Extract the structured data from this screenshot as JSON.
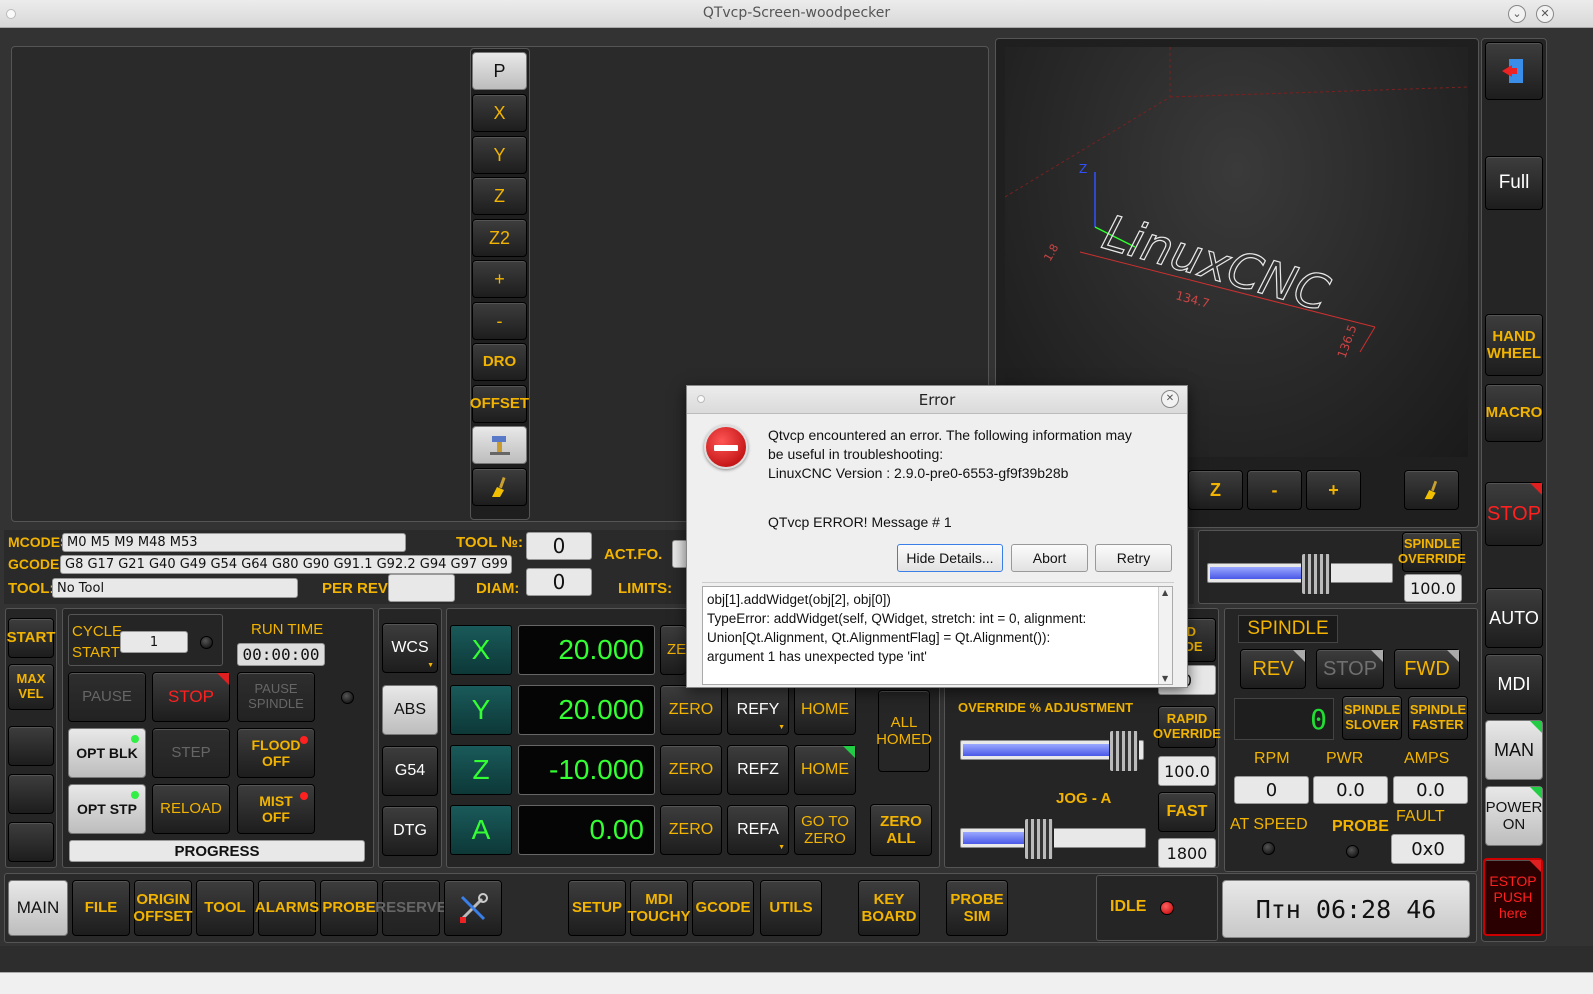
{
  "window": {
    "title": "QTvcp-Screen-woodpecker"
  },
  "quick_buttons": [
    "P",
    "X",
    "Y",
    "Z",
    "Z2",
    "+",
    "-",
    "DRO",
    "OFFSET"
  ],
  "right_nav": {
    "full": "Full",
    "hand_wheel": "HAND\nWHEEL",
    "macro": "MACRO",
    "stop": "STOP",
    "auto": "AUTO",
    "mdi": "MDI",
    "man": "MAN",
    "power_on": "POWER\nON",
    "estop": "ESTOP\nPUSH\nhere"
  },
  "preview": {
    "buttons": [
      "Z",
      "-",
      "+"
    ],
    "dims": {
      "d1": "134.7",
      "d2": "136.5",
      "d3": "1.8"
    },
    "logo": "LinuxCNC"
  },
  "codes": {
    "mcodes_label": "MCODES:",
    "mcodes": "M0 M5 M9 M48 M53",
    "gcodes_label": "GCODES:",
    "gcodes": "G8 G17 G21 G40 G49 G54 G64 G80 G90 G91.1 G92.2 G94 G97 G99",
    "tool_label": "TOOL:",
    "tool": "No Tool",
    "tool_no_label": "TOOL №:",
    "tool_no": "0",
    "per_rev_label": "PER REV:",
    "diam_label": "DIAM:",
    "diam": "0",
    "act_fo_label": "ACT.FO.",
    "limits_label": "LIMITS:"
  },
  "run": {
    "start": "START",
    "max_vel": "MAX\nVEL",
    "cycle_start": "CYCLE\nSTART",
    "cycle_value": "1",
    "run_time_label": "RUN TIME",
    "run_time": "00:00:00",
    "pause": "PAUSE",
    "stop": "STOP",
    "pause_spindle": "PAUSE\nSPINDLE",
    "opt_blk": "OPT BLK",
    "step": "STEP",
    "flood_off": "FLOOD\nOFF",
    "opt_stp": "OPT STP",
    "reload": "RELOAD",
    "mist_off": "MIST\nOFF",
    "progress": "PROGRESS"
  },
  "coord_modes": [
    "WCS",
    "ABS",
    "G54",
    "DTG"
  ],
  "axes": [
    {
      "name": "X",
      "value": "20.000",
      "ref": "REFX",
      "home": "HOME"
    },
    {
      "name": "Y",
      "value": "20.000",
      "ref": "REFY",
      "home": "HOME"
    },
    {
      "name": "Z",
      "value": "-10.000",
      "ref": "REFZ",
      "home": "HOME"
    },
    {
      "name": "A",
      "value": "0.00",
      "ref": "REFA",
      "home": "GO TO\nZERO"
    }
  ],
  "zero_label": "ZE",
  "zero": "ZERO",
  "all_homed": "ALL\nHOMED",
  "zero_all": "ZERO\nALL",
  "overrides": {
    "spindle_override": "SPINDLE\nOVERRIDE",
    "spindle_override_value": "100.0",
    "feed_override": "ED\nRIDE",
    "feed_value": "0",
    "adjust_label": "OVERRIDE % ADJUSTMENT",
    "rapid_override": "RAPID\nOVERRIDE",
    "rapid_value": "100.0",
    "jog_label": "JOG - A",
    "fast": "FAST",
    "jog_value": "1800",
    "slider_spindle_pct": 0.62,
    "slider_rapid_pct": 1.0,
    "slider_jog_pct": 0.42
  },
  "spindle": {
    "title": "SPINDLE",
    "rev": "REV",
    "stop": "STOP",
    "fwd": "FWD",
    "lcd": "0",
    "slower": "SPINDLE\nSLOVER",
    "faster": "SPINDLE\nFASTER",
    "rpm_label": "RPM",
    "rpm": "0",
    "pwr_label": "PWR",
    "pwr": "0.0",
    "amps_label": "AMPS",
    "amps": "0.0",
    "at_speed": "AT SPEED",
    "probe": "PROBE",
    "fault_label": "FAULT",
    "fault": "0x0"
  },
  "bottom_tabs": [
    "MAIN",
    "FILE",
    "ORIGIN\nOFFSET",
    "TOOL",
    "ALARMS",
    "PROBE",
    "RESERVE"
  ],
  "bottom_tabs2": [
    "SETUP",
    "MDI\nTOUCHY",
    "GCODE",
    "UTILS"
  ],
  "key_board": "KEY\nBOARD",
  "probe_sim": "PROBE\nSIM",
  "status": "IDLE",
  "clock": "Птн 06:28 46",
  "dialog": {
    "title": "Error",
    "message": "Qtvcp encountered an error.  The following information may\nbe useful in troubleshooting:\nLinuxCNC Version  : 2.9.0-pre0-6553-gf9f39b28b",
    "message2": "QTvcp ERROR! Message # 1",
    "hide": "Hide Details...",
    "abort": "Abort",
    "retry": "Retry",
    "details": "    obj[1].addWidget(obj[2], obj[0])\nTypeError: addWidget(self, QWidget, stretch: int = 0, alignment:\nUnion[Qt.Alignment, Qt.AlignmentFlag] = Qt.Alignment()):\nargument 1 has unexpected type 'int'"
  },
  "colors": {
    "accent": "#f2b400",
    "dro_green": "#33ff33",
    "stop_red": "#ff2020",
    "bg": "#333333"
  }
}
